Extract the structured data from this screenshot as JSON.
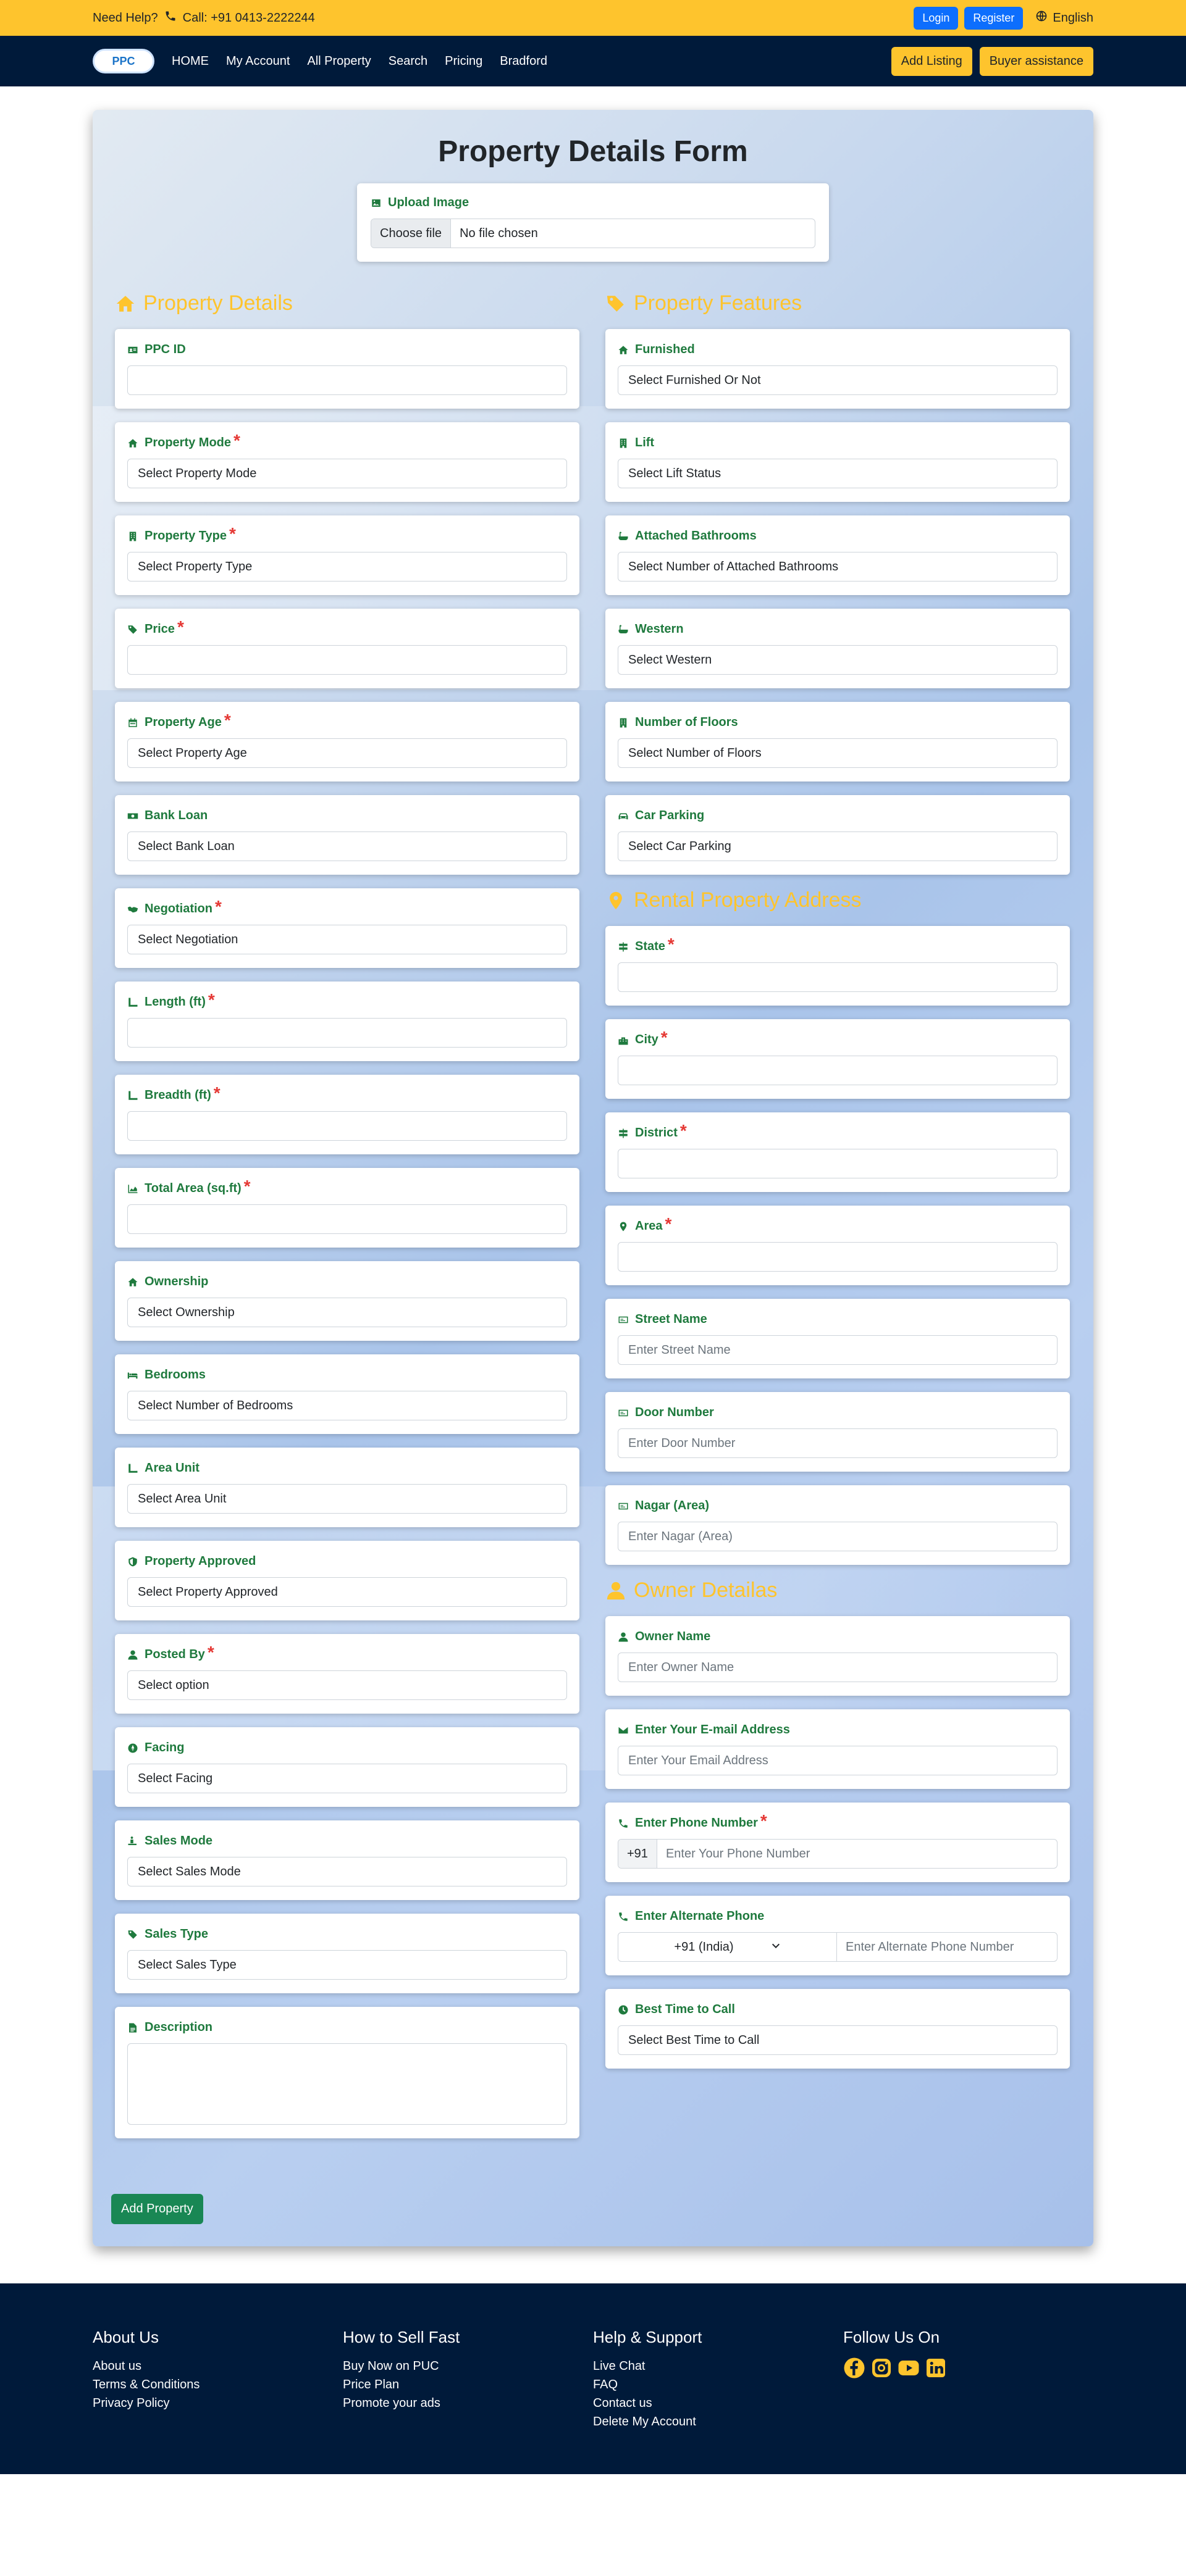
{
  "colors": {
    "accent": "#fec42d",
    "nav": "#001a3a",
    "label_green": "#1f7a3e",
    "primary": "#0d6efd",
    "success": "#198754",
    "required": "#e53935"
  },
  "topbar": {
    "help": "Need Help?",
    "call": "Call: +91 0413-2222244",
    "login": "Login",
    "register": "Register",
    "language": "English"
  },
  "nav": {
    "logo": "PPC",
    "links": [
      "HOME",
      "My Account",
      "All Property",
      "Search",
      "Pricing",
      "Bradford"
    ],
    "add_listing": "Add Listing",
    "buyer_assistance": "Buyer assistance"
  },
  "form": {
    "title": "Property Details Form",
    "upload": {
      "label": "Upload Image",
      "button": "Choose file",
      "status": "No file chosen"
    },
    "left_title": "Property Details",
    "right_title": "Property Features",
    "address_title": "Rental Property Address",
    "owner_title": "Owner Detailas",
    "submit": "Add Property",
    "property_details": [
      {
        "label": "PPC ID",
        "value": "",
        "icon": "id-card-icon"
      },
      {
        "label": "Property Mode",
        "value": "Select Property Mode",
        "icon": "home-icon",
        "required": true
      },
      {
        "label": "Property Type",
        "value": "Select Property Type",
        "icon": "building-icon",
        "required": true
      },
      {
        "label": "Price",
        "value": "",
        "icon": "tag-icon",
        "required": true
      },
      {
        "label": "Property Age",
        "value": "Select Property Age",
        "icon": "calendar-icon",
        "required": true
      },
      {
        "label": "Bank Loan",
        "value": "Select Bank Loan",
        "icon": "money-icon"
      },
      {
        "label": "Negotiation",
        "value": "Select Negotiation",
        "icon": "handshake-icon",
        "required": true
      },
      {
        "label": "Length (ft)",
        "value": "",
        "icon": "ruler-icon",
        "required": true
      },
      {
        "label": "Breadth (ft)",
        "value": "",
        "icon": "ruler-icon",
        "required": true
      },
      {
        "label": "Total Area (sq.ft)",
        "value": "",
        "icon": "area-chart-icon",
        "required": true
      },
      {
        "label": "Ownership",
        "value": "Select Ownership",
        "icon": "home-icon"
      },
      {
        "label": "Bedrooms",
        "value": "Select Number of Bedrooms",
        "icon": "bed-icon"
      },
      {
        "label": "Area Unit",
        "value": "Select Area Unit",
        "icon": "ruler-icon"
      },
      {
        "label": "Property Approved",
        "value": "Select Property Approved",
        "icon": "shield-icon"
      },
      {
        "label": "Posted By",
        "value": "Select option",
        "icon": "user-icon",
        "required": true
      },
      {
        "label": "Facing",
        "value": "Select Facing",
        "icon": "compass-icon"
      },
      {
        "label": "Sales Mode",
        "value": "Select Sales Mode",
        "icon": "person-sales-icon"
      },
      {
        "label": "Sales Type",
        "value": "Select Sales Type",
        "icon": "tag-icon"
      },
      {
        "label": "Description",
        "value": "",
        "icon": "file-icon",
        "textarea": true
      }
    ],
    "property_features": [
      {
        "label": "Furnished",
        "value": "Select Furnished Or Not",
        "icon": "home-icon"
      },
      {
        "label": "Lift",
        "value": "Select Lift Status",
        "icon": "building-icon"
      },
      {
        "label": "Attached Bathrooms",
        "value": "Select Number of Attached Bathrooms",
        "icon": "bath-icon"
      },
      {
        "label": "Western",
        "value": "Select Western",
        "icon": "bath-icon"
      },
      {
        "label": "Number of Floors",
        "value": "Select Number of Floors",
        "icon": "building-icon"
      },
      {
        "label": "Car Parking",
        "value": "Select Car Parking",
        "icon": "car-icon"
      }
    ],
    "address": [
      {
        "label": "State",
        "value": "",
        "icon": "signpost-icon",
        "required": true
      },
      {
        "label": "City",
        "value": "",
        "icon": "city-icon",
        "required": true
      },
      {
        "label": "District",
        "value": "",
        "icon": "signpost-icon",
        "required": true
      },
      {
        "label": "Area",
        "value": "",
        "icon": "map-pin-icon",
        "required": true
      },
      {
        "label": "Street Name",
        "placeholder": "Enter Street Name",
        "icon": "road-sign-icon"
      },
      {
        "label": "Door Number",
        "placeholder": "Enter Door Number",
        "icon": "road-sign-icon"
      },
      {
        "label": "Nagar (Area)",
        "placeholder": "Enter Nagar (Area)",
        "icon": "road-sign-icon"
      }
    ],
    "owner": {
      "name": {
        "label": "Owner Name",
        "placeholder": "Enter Owner Name"
      },
      "email": {
        "label": "Enter Your E-mail Address",
        "placeholder": "Enter Your Email Address"
      },
      "phone": {
        "label": "Enter Phone Number",
        "prefix": "+91",
        "placeholder": "Enter Your Phone Number"
      },
      "alt_phone": {
        "label": "Enter Alternate Phone",
        "country": "+91 (India)",
        "placeholder": "Enter Alternate Phone Number"
      },
      "best_time": {
        "label": "Best Time to Call",
        "value": "Select Best Time to Call"
      }
    }
  },
  "footer": {
    "about": {
      "title": "About Us",
      "links": [
        "About us",
        "Terms & Conditions",
        "Privacy Policy"
      ]
    },
    "sell": {
      "title": "How to Sell Fast",
      "links": [
        "Buy Now on PUC",
        "Price Plan",
        "Promote your ads"
      ]
    },
    "help": {
      "title": "Help & Support",
      "links": [
        "Live Chat",
        "FAQ",
        "Contact us",
        "Delete My Account"
      ]
    },
    "follow": {
      "title": "Follow Us On",
      "icons": [
        "facebook-icon",
        "instagram-icon",
        "youtube-icon",
        "linkedin-icon"
      ]
    }
  }
}
